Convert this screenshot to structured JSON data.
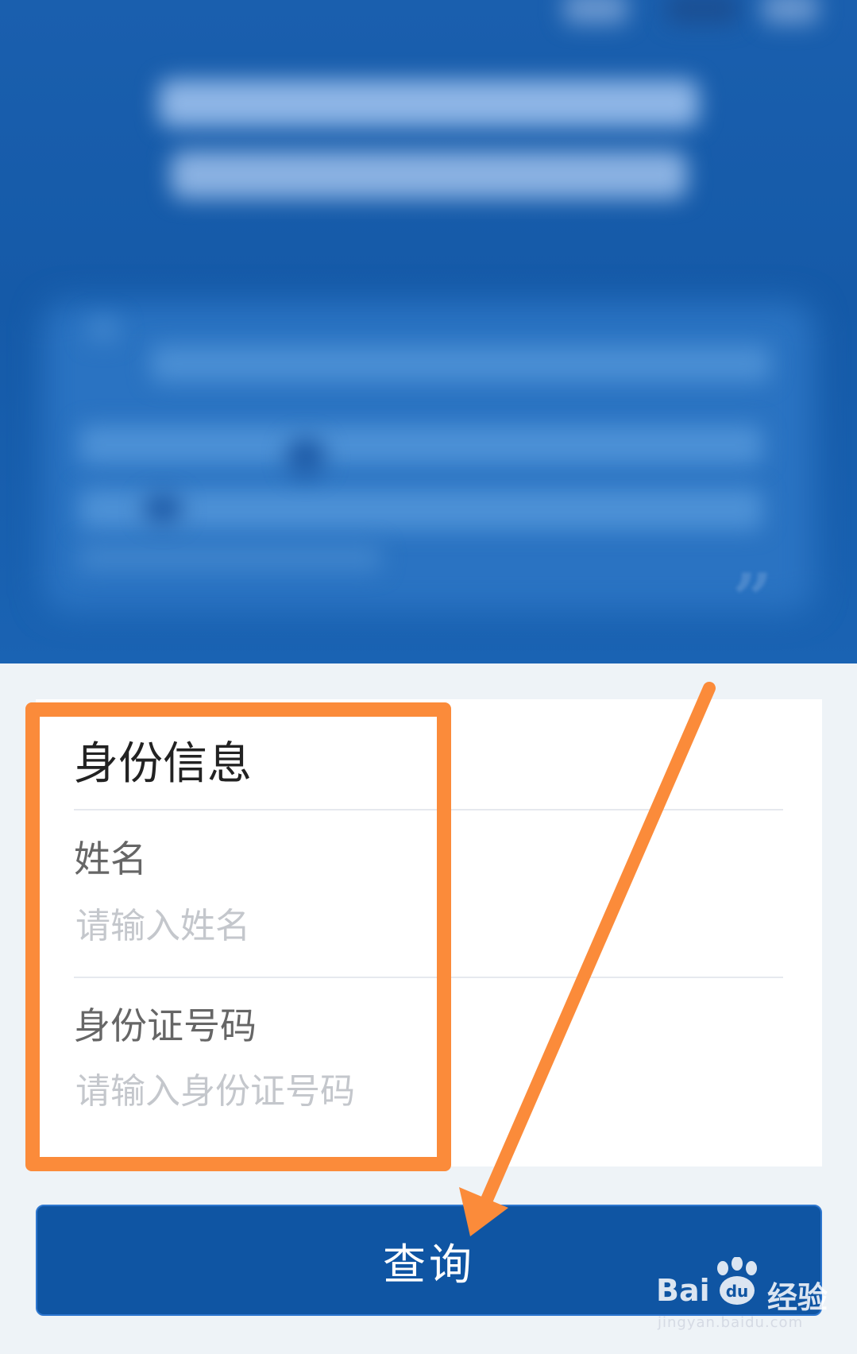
{
  "banner": {
    "quote_glyph": "”"
  },
  "identity_section": {
    "title": "身份信息",
    "name_label": "姓名",
    "name_placeholder": "请输入姓名",
    "id_label": "身份证号码",
    "id_placeholder": "请输入身份证号码"
  },
  "actions": {
    "query_label": "查询"
  },
  "annotation": {
    "color": "#fb8b3a"
  },
  "watermark": {
    "brand_prefix": "Bai",
    "brand_suffix": "经验",
    "url": "jingyan.baidu.com"
  },
  "colors": {
    "primary": "#0f55a3",
    "page_bg": "#eef3f7"
  }
}
